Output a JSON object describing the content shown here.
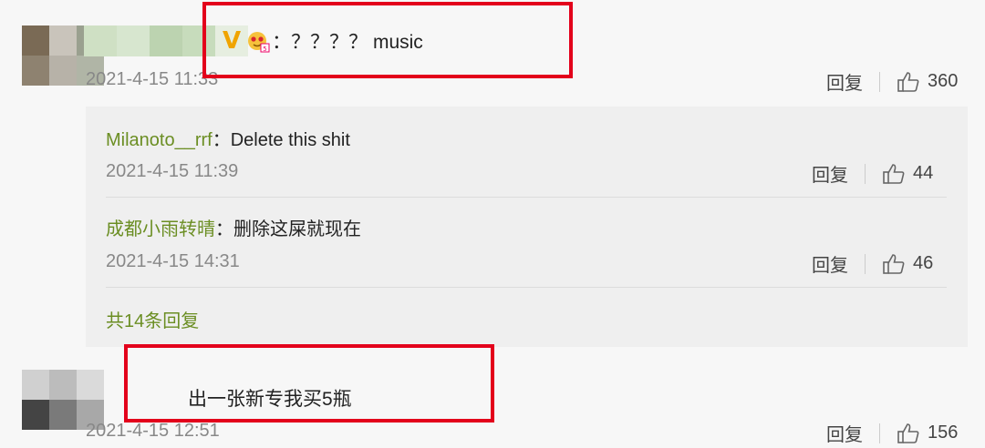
{
  "comments": [
    {
      "text": "：？？？？ music",
      "timestamp": "2021-4-15 11:33",
      "reply_label": "回复",
      "likes": "360",
      "avatar_colors": [
        "#7a6a55",
        "#c9c4bb",
        "#9aa08f",
        "#8e8270",
        "#b7b2a8",
        "#b0b5a6"
      ],
      "name_colors": [
        "#cfe0c4",
        "#d7e6cf",
        "#bcd3b0",
        "#c7dcbc",
        "#e6eee0"
      ]
    },
    {
      "text": "出一张新专我买5瓶",
      "timestamp": "2021-4-15 12:51",
      "reply_label": "回复",
      "likes": "156",
      "avatar_colors": [
        "#d0d0d0",
        "#bcbcbc",
        "#dadada",
        "#444444",
        "#7a7a7a",
        "#a8a8a8"
      ]
    }
  ],
  "replies": [
    {
      "user": "Milanoto__rrf",
      "text": "：Delete this shit",
      "timestamp": "2021-4-15 11:39",
      "reply_label": "回复",
      "likes": "44"
    },
    {
      "user": "成都小雨转晴",
      "text": "：删除这屎就现在",
      "timestamp": "2021-4-15 14:31",
      "reply_label": "回复",
      "likes": "46"
    }
  ],
  "more_replies": "共14条回复",
  "icons": {
    "vip": "V",
    "like": "thumbs-up-icon",
    "badge": "emoji-badge-icon"
  },
  "colors": {
    "highlight": "#e3001b",
    "username": "#6b8e23",
    "vip": "#f0a400"
  }
}
